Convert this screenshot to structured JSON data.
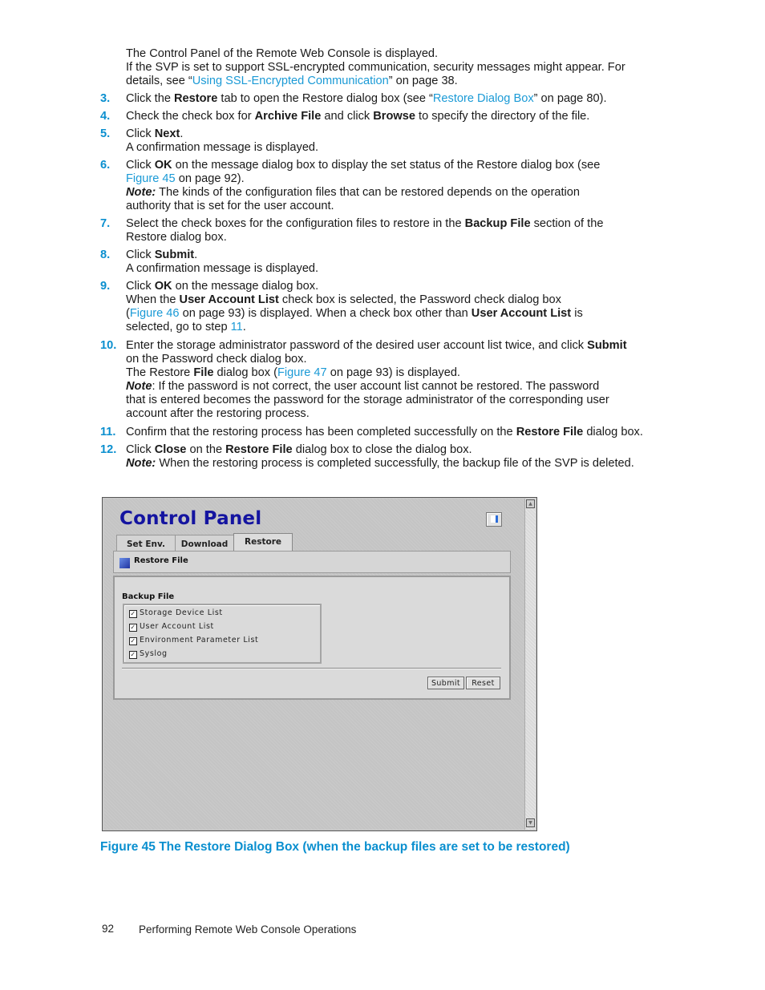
{
  "intro": {
    "line1": "The Control Panel of the Remote Web Console is displayed.",
    "line2": "If the SVP is set to support SSL-encrypted communication, security messages might appear.  For",
    "line3_pre": "details, see “",
    "line3_link": "Using SSL-Encrypted Communication",
    "line3_post": "” on page 38."
  },
  "steps": {
    "s3": {
      "num": "3.",
      "t1": "Click the ",
      "b1": "Restore",
      "t2": " tab to open the Restore dialog box (see “",
      "link": "Restore Dialog Box",
      "t3": "” on page 80)."
    },
    "s4": {
      "num": "4.",
      "t1": "Check the check box for ",
      "b1": "Archive File",
      "t2": " and click ",
      "b2": "Browse",
      "t3": " to specify the directory of the file."
    },
    "s5": {
      "num": "5.",
      "t1": "Click ",
      "b1": "Next",
      "t2": ".",
      "line2": "A confirmation message is displayed."
    },
    "s6": {
      "num": "6.",
      "t1": "Click ",
      "b1": "OK",
      "t2": " on the message dialog box to display the set status of the Restore dialog box (see",
      "link": "Figure 45",
      "t3": " on page 92).",
      "note_label": "Note:",
      "note1": " The kinds of the configuration files that can be restored depends on the operation",
      "note2": "authority that is set for the user account."
    },
    "s7": {
      "num": "7.",
      "t1": "Select the check boxes for the configuration files to restore in the ",
      "b1": "Backup File",
      "t2": " section of the",
      "line2": "Restore dialog box."
    },
    "s8": {
      "num": "8.",
      "t1": "Click ",
      "b1": "Submit",
      "t2": ".",
      "line2": "A confirmation message is displayed."
    },
    "s9": {
      "num": "9.",
      "t1": "Click ",
      "b1": "OK",
      "t2": " on the message dialog box.",
      "l2a": "When the ",
      "l2b": "User Account List",
      "l2c": " check box is selected, the Password check dialog box",
      "l3a": "(",
      "l3link": "Figure 46",
      "l3b": " on page 93) is displayed.  When a check box other than ",
      "l3bold": "User Account List",
      "l3c": " is",
      "l4a": "selected, go to step ",
      "l4link": "11",
      "l4b": "."
    },
    "s10": {
      "num": "10.",
      "t1": "Enter the storage administrator password of the desired user account list twice, and click ",
      "b1": "Submit",
      "line2": "on the Password check dialog box.",
      "l3a": "The Restore ",
      "l3bold": "File",
      "l3b": " dialog box (",
      "l3link": "Figure 47",
      "l3c": " on page 93) is displayed.",
      "note_label": "Note",
      "note1": ":  If the password is not correct, the user account list cannot be restored.  The password",
      "note2": "that is entered becomes the password for the storage administrator of the corresponding user",
      "note3": "account after the restoring process."
    },
    "s11": {
      "num": "11.",
      "t1": "Confirm that the restoring process has been completed successfully on the ",
      "b1": "Restore File",
      "t2": " dialog box."
    },
    "s12": {
      "num": "12.",
      "t1": "Click ",
      "b1": "Close",
      "t2": " on the ",
      "b2": "Restore File",
      "t3": " dialog box to close the dialog box.",
      "note_label": "Note:",
      "note1": " When the restoring process is completed successfully, the backup file of the SVP is deleted."
    }
  },
  "screenshot": {
    "title": "Control Panel",
    "help_icon": "speaker-help-icon",
    "tabs": [
      {
        "label": "Set Env.",
        "active": false
      },
      {
        "label": "Download",
        "active": false
      },
      {
        "label": "Restore",
        "active": true
      }
    ],
    "section_title": "Restore File",
    "backup_file_label": "Backup File",
    "checkboxes": [
      {
        "label": "Storage Device List",
        "checked": true
      },
      {
        "label": "User Account List",
        "checked": true
      },
      {
        "label": "Environment Parameter List",
        "checked": true
      },
      {
        "label": "Syslog",
        "checked": true
      }
    ],
    "check_glyph": "✓",
    "submit_label": "Submit",
    "reset_label": "Reset",
    "scroll_up_glyph": "▲",
    "scroll_down_glyph": "▼"
  },
  "caption": "Figure 45 The Restore Dialog Box (when the backup files are set to be restored)",
  "footer": {
    "page_number": "92",
    "title": "Performing Remote Web Console Operations"
  },
  "colors": {
    "accent": "#0a8fcf",
    "link": "#1a9ad6",
    "panel_title": "#1414a0"
  }
}
